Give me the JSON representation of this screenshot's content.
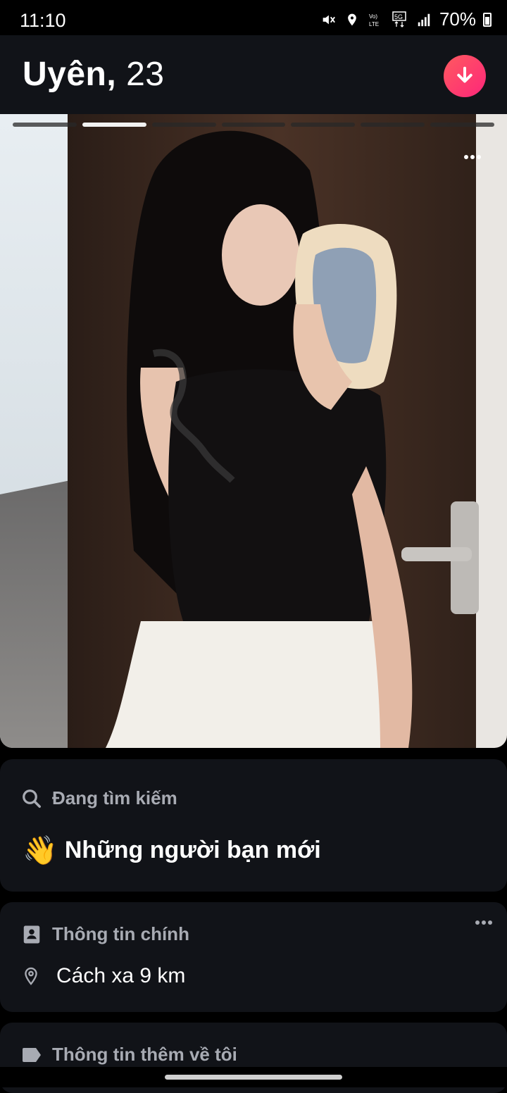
{
  "status_bar": {
    "time": "11:10",
    "battery": "70%",
    "icons": [
      "mute-icon",
      "location-icon",
      "volte-icon",
      "5g-icon",
      "signal-icon",
      "battery-icon"
    ]
  },
  "profile": {
    "name": "Uyên,",
    "age": "23"
  },
  "photo": {
    "count": 7,
    "active_index": 1
  },
  "looking_for": {
    "label": "Đang tìm kiếm",
    "emoji": "👋",
    "value": "Những người bạn mới"
  },
  "basics": {
    "label": "Thông tin chính",
    "distance": "Cách xa 9 km"
  },
  "more_about": {
    "label": "Thông tin thêm về tôi"
  },
  "colors": {
    "accent_start": "#ff5a5f",
    "accent_end": "#fd267a",
    "card_bg": "#111318"
  }
}
